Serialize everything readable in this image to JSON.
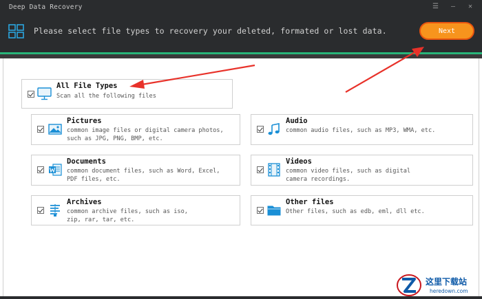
{
  "app": {
    "title": "Deep Data Recovery",
    "instruction": "Please select file types to recovery your deleted, formated or lost data.",
    "next_label": "Next",
    "window_controls": {
      "menu_glyph": "☰",
      "minimize_glyph": "—",
      "close_glyph": "✕"
    },
    "colors": {
      "accent_green": "#29b57a",
      "next_orange": "#f7941d",
      "arrow_red": "#e8322a",
      "icon_blue": "#1a8fd6"
    }
  },
  "all_types": {
    "title": "All File Types",
    "desc": "Scan all the following files",
    "checked": true,
    "icon": "monitor-icon"
  },
  "file_types": [
    {
      "title": "Pictures",
      "desc": "common image files or digital camera photos, such as JPG, PNG, BMP, etc.",
      "checked": true,
      "icon": "picture-icon"
    },
    {
      "title": "Audio",
      "desc": "common audio files, such as MP3, WMA, etc.",
      "checked": true,
      "icon": "music-note-icon"
    },
    {
      "title": "Documents",
      "desc": "common document files, such as Word, Excel, PDF files, etc.",
      "checked": true,
      "icon": "word-document-icon"
    },
    {
      "title": "Videos",
      "desc": "common video files, such as digital camera recordings.",
      "checked": true,
      "icon": "film-icon"
    },
    {
      "title": "Archives",
      "desc": "common archive files, such as iso, zip, rar, tar, etc.",
      "checked": true,
      "icon": "archive-icon"
    },
    {
      "title": "Other files",
      "desc": "Other files, such as edb, eml, dll etc.",
      "checked": true,
      "icon": "folder-icon"
    }
  ],
  "watermark": {
    "chinese": "这里下载站",
    "english": "heredown.com"
  }
}
